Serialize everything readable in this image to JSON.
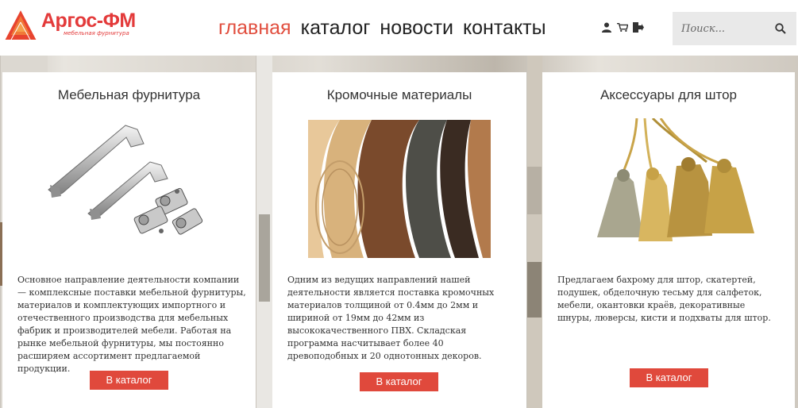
{
  "header": {
    "logo": {
      "name": "Аргос-ФМ",
      "tagline": "мебельная фурнитура"
    },
    "nav": [
      {
        "label": "главная",
        "active": true
      },
      {
        "label": "каталог",
        "active": false
      },
      {
        "label": "новости",
        "active": false
      },
      {
        "label": "контакты",
        "active": false
      }
    ],
    "icons": [
      "user-icon",
      "cart-icon",
      "logout-icon"
    ],
    "search": {
      "placeholder": "Поиск..."
    }
  },
  "colors": {
    "accent": "#e14e3e",
    "button": "#e0493c",
    "logo": "#e33a3a"
  },
  "cards": [
    {
      "title": "Мебельная фурнитура",
      "image": "furniture-handles-hinges",
      "text": "Основное направление деятельности компании — комплексные поставки мебельной фурнитуры, материалов и комплектующих импортного и отечественного производства для мебельных фабрик и производителей мебели. Работая на рынке мебельной фурнитуры, мы постоянно расширяем ассортимент предлагаемой продукции.",
      "button": "В каталог"
    },
    {
      "title": "Кромочные материалы",
      "image": "edge-banding-rolls",
      "text": "Одним из ведущих направлений нашей деятельности является поставка кромочных материалов толщиной от 0.4мм до 2мм и шириной от 19мм до 42мм из высококачественного ПВХ. Складская программа насчитывает более 40 древоподобных и 20 однотонных декоров.",
      "button": "В каталог"
    },
    {
      "title": "Аксессуары для штор",
      "image": "curtain-tassels",
      "text": "Предлагаем бахрому для штор, скатертей, подушек, обделочную тесьму для салфеток, мебели, окантовки краёв, декоративные шнуры, люверсы, кисти и подхваты для штор.",
      "button": "В каталог"
    }
  ]
}
